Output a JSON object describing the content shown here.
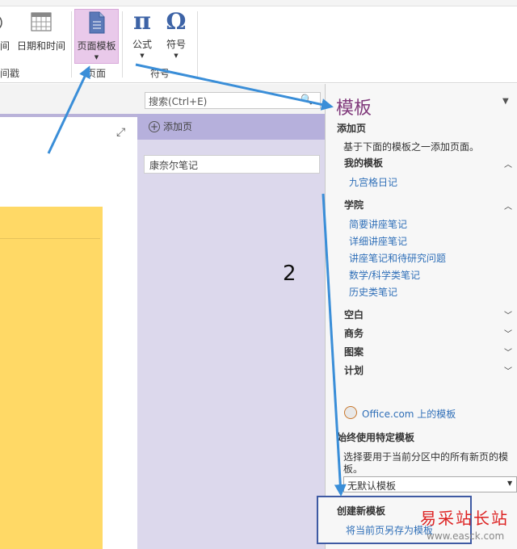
{
  "ribbon": {
    "partial_button": "间",
    "datetime_button": "日期和时间",
    "timestamp_group": "时间戳",
    "page_template_button": "页面模板",
    "page_group": "页面",
    "formula_button": "公式",
    "symbol_button": "符号",
    "symbol_group": "符号",
    "pi_glyph": "π",
    "omega_glyph": "Ω"
  },
  "search": {
    "placeholder": "搜索(Ctrl+E)"
  },
  "pages": {
    "add_page": "添加页",
    "items": [
      "康奈尔笔记"
    ]
  },
  "annotation_number": "2",
  "templates_panel": {
    "title": "模板",
    "add_page_heading": "添加页",
    "add_page_desc": "基于下面的模板之一添加页面。",
    "my_templates": "我的模板",
    "my_templates_items": [
      "九宫格日记"
    ],
    "academic": "学院",
    "academic_items": [
      "简要讲座笔记",
      "详细讲座笔记",
      "讲座笔记和待研究问题",
      "数学/科学类笔记",
      "历史类笔记"
    ],
    "collapsed_categories": [
      "空白",
      "商务",
      "图案",
      "计划"
    ],
    "office_link": "Office.com 上的模板",
    "always_use_heading": "始终使用特定模板",
    "always_use_desc_line1": "选择要用于当前分区中的所有新页的模",
    "always_use_desc_line2": "板。",
    "default_select": "无默认模板",
    "create_heading": "创建新模板",
    "save_as_link": "将当前页另存为模板"
  },
  "watermark": {
    "line1": "易采站长站",
    "line2": "www.easck.com"
  },
  "colors": {
    "accent_purple": "#80397b",
    "arrow_blue": "#3a8ed8",
    "page_yellow": "#ffd966"
  }
}
